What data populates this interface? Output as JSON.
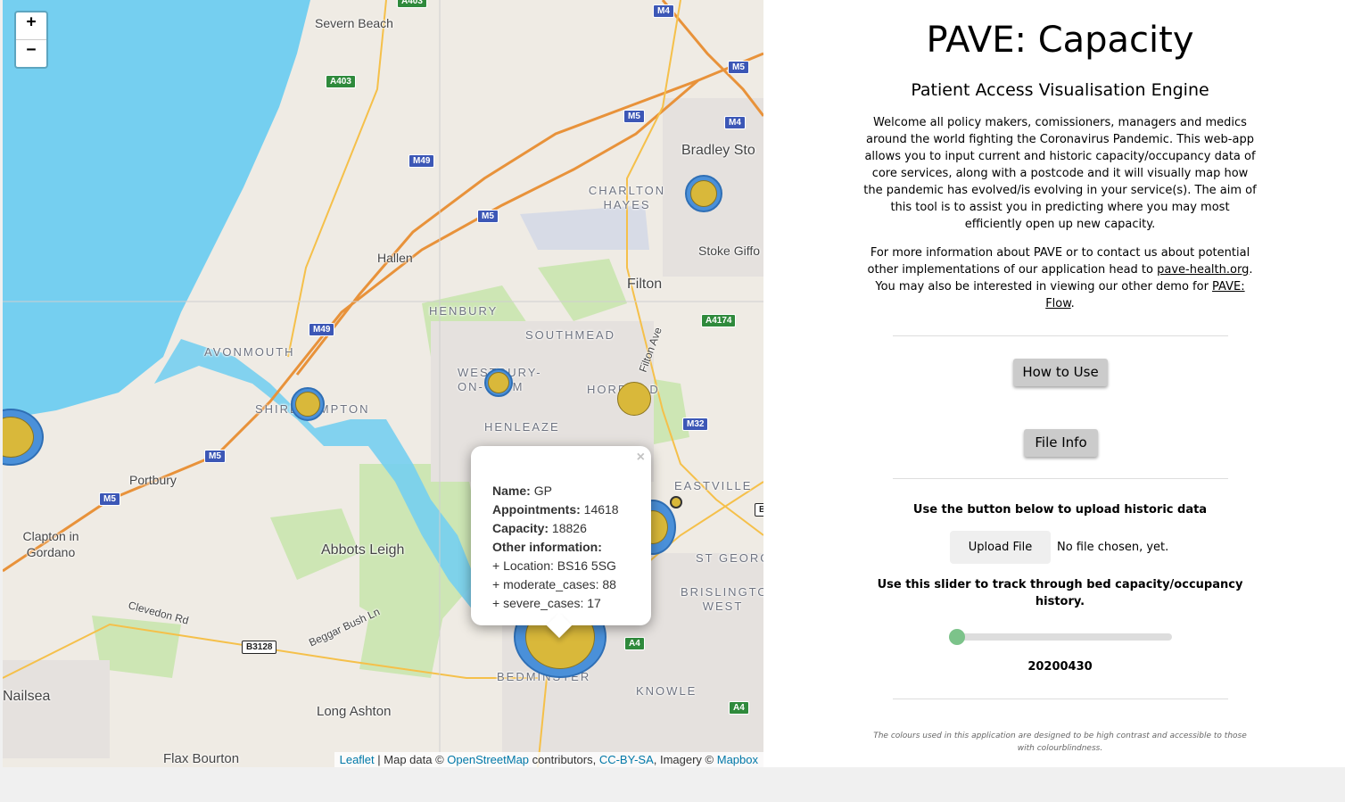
{
  "map": {
    "zoom_in": "+",
    "zoom_out": "−",
    "places": {
      "severn_beach": "Severn Beach",
      "hallen": "Hallen",
      "avonmouth": "AVONMOUTH",
      "shirehampton": "SHIREHAMPTON",
      "henbury": "HENBURY",
      "southmead": "SOUTHMEAD",
      "westbury": "WESTBURY-ON-TRYM",
      "horfield": "HORFIELD",
      "henleaze": "HENLEAZE",
      "filton": "Filton",
      "charlton_hayes": "CHARLTON HAYES",
      "bradley_stoke": "Bradley Sto",
      "stoke_gifford": "Stoke Giffo",
      "portbury": "Portbury",
      "clapton": "Clapton in Gordano",
      "abbots_leigh": "Abbots Leigh",
      "eastville": "EASTVILLE",
      "st_george": "ST GEORG",
      "brislington": "BRISLINGTO WEST",
      "bedminster": "BEDMINSTER",
      "knowle": "KNOWLE",
      "nailsea": "Nailsea",
      "long_ashton": "Long Ashton",
      "flax_bourton": "Flax Bourton",
      "clevedon_rd": "Clevedon Rd",
      "beggar_bush": "Beggar Bush Ln",
      "filton_ave": "Filton Ave"
    },
    "roads": {
      "a403_top": "A403",
      "a403": "A403",
      "m4": "M4",
      "m5_a": "M5",
      "m5_b": "M5",
      "m4_b": "M4",
      "m49_a": "M49",
      "m5_c": "M5",
      "m49_b": "M49",
      "a4174": "A4174",
      "m32": "M32",
      "m5_d": "M5",
      "m5_e": "M5",
      "b3128": "B3128",
      "a4_a": "A4",
      "a4_b": "A4",
      "b_edge": "B"
    },
    "popup": {
      "close": "×",
      "name_label": "Name:",
      "name_value": "GP",
      "appointments_label": "Appointments:",
      "appointments_value": "14618",
      "capacity_label": "Capacity:",
      "capacity_value": "18826",
      "other_label": "Other information:",
      "location": "+ Location: BS16 5SG",
      "moderate": "+ moderate_cases: 88",
      "severe": "+ severe_cases: 17"
    },
    "attribution": {
      "leaflet": "Leaflet",
      "sep1": " | Map data © ",
      "osm": "OpenStreetMap",
      "sep2": " contributors, ",
      "license": "CC-BY-SA",
      "sep3": ", Imagery © ",
      "mapbox": "Mapbox"
    },
    "colors": {
      "water": "#75cff0",
      "marker_outer": "#4a90d9",
      "marker_inner": "#d9b83a",
      "motorway": "#e8923a"
    }
  },
  "panel": {
    "title": "PAVE: Capacity",
    "subtitle": "Patient Access Visualisation Engine",
    "intro": "Welcome all policy makers, comissioners, managers and medics around the world fighting the Coronavirus Pandemic. This web-app allows you to input current and historic capacity/occupancy data of core services, along with a postcode and it will visually map how the pandemic has evolved/is evolving in your service(s). The aim of this tool is to assist you in predicting where you may most efficiently open up new capacity.",
    "more_info_pre": "For more information about PAVE or to contact us about potential other implementations of our application head to ",
    "more_info_link": "pave-health.org",
    "more_info_mid": ". You may also be interested in viewing our other demo for ",
    "flow_link": "PAVE: Flow",
    "more_info_end": ".",
    "how_to_use": "How to Use",
    "file_info": "File Info",
    "upload_label": "Use the button below to upload historic data",
    "upload_button": "Upload File",
    "no_file": "No file chosen, yet.",
    "slider_label": "Use this slider to track through bed capacity/occupancy history.",
    "slider_value_fraction": 0,
    "date": "20200430",
    "footnote": "The colours used in this application are designed to be high contrast and accessible to those with colourblindness."
  }
}
